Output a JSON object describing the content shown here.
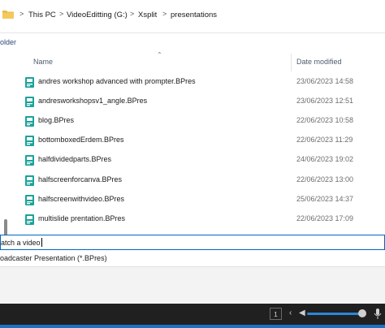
{
  "address_bar": {
    "crumbs": [
      "This PC",
      "VideoEditting (G:)",
      "Xsplit",
      "presentations"
    ],
    "separator": ">"
  },
  "toolbar": {
    "new_folder_label": "older"
  },
  "columns": {
    "name": "Name",
    "date_modified": "Date modified"
  },
  "files": [
    {
      "name": "andres workshop advanced with prompter.BPres",
      "date": "23/06/2023 14:58"
    },
    {
      "name": "andresworkshopsv1_angle.BPres",
      "date": "23/06/2023 12:51"
    },
    {
      "name": "blog.BPres",
      "date": "22/06/2023 10:58"
    },
    {
      "name": "bottomboxedErdem.BPres",
      "date": "22/06/2023 11:29"
    },
    {
      "name": "halfdividedparts.BPres",
      "date": "24/06/2023 19:02"
    },
    {
      "name": "halfscreenforcanva.BPres",
      "date": "22/06/2023 13:00"
    },
    {
      "name": "halfscreenwithvideo.BPres",
      "date": "25/06/2023 14:37"
    },
    {
      "name": "multislide prentation.BPres",
      "date": "22/06/2023 17:09"
    }
  ],
  "file_name_field": {
    "value": "atch a video"
  },
  "file_type": {
    "value": "oadcaster Presentation (*.BPres)"
  },
  "player": {
    "page_number": "1"
  },
  "colors": {
    "file_icon": "#1aa39a",
    "accent": "#0067c0",
    "player_bg": "#202020"
  }
}
